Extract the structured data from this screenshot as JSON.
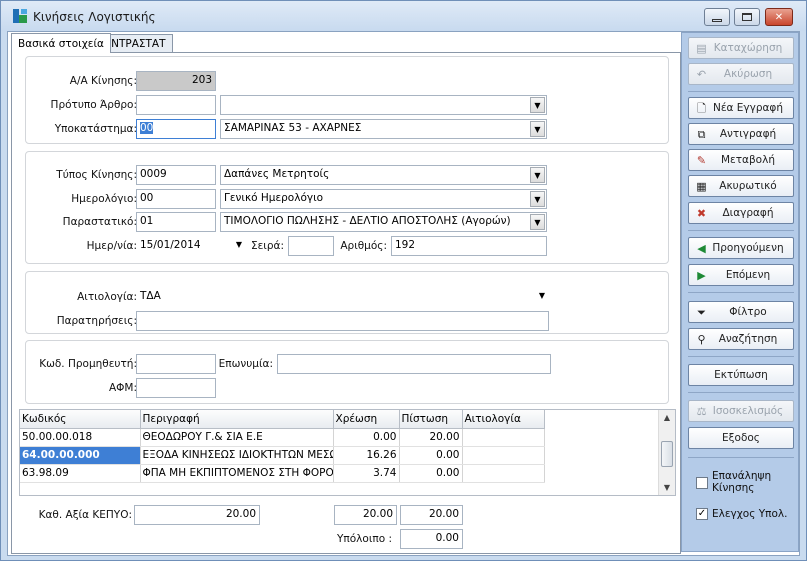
{
  "window": {
    "title": "Κινήσεις Λογιστικής",
    "controls": {
      "minimize": "▭",
      "maximize": "▢",
      "close": "✕"
    }
  },
  "tabs": [
    {
      "label": "Βασικά στοιχεία",
      "active": true
    },
    {
      "label": "ΙΝΤΡΑΣΤΑΤ",
      "active": false
    }
  ],
  "header": {
    "aa_label": "Α/Α Κίνησης:",
    "aa_value": "203",
    "template_label": "Πρότυπο Άρθρο:",
    "template_code": "",
    "template_name": "",
    "branch_label": "Υποκατάστημα:",
    "branch_code": "00",
    "branch_name": "ΣΑΜΑΡΙΝΑΣ 53 - ΑΧΑΡΝΕΣ"
  },
  "movement": {
    "type_label": "Τύπος Κίνησης:",
    "type_code": "0009",
    "type_name": "Δαπάνες Μετρητοίς",
    "journal_label": "Ημερολόγιο:",
    "journal_code": "00",
    "journal_name": "Γενικό Ημερολόγιο",
    "doc_label": "Παραστατικό:",
    "doc_code": "01",
    "doc_name": "ΤΙΜΟΛΟΓΙΟ ΠΩΛΗΣΗΣ - ΔΕΛΤΙΟ ΑΠΟΣΤΟΛΗΣ (Αγορών)",
    "date_label": "Ημερ/νία:",
    "date_value": "15/01/2014",
    "series_label": "Σειρά:",
    "series_value": "",
    "number_label": "Αριθμός:",
    "number_value": "192"
  },
  "reason": {
    "reason_label": "Αιτιολογία:",
    "reason_value": "ΤΔΑ",
    "notes_label": "Παρατηρήσεις:",
    "notes_value": ""
  },
  "supplier": {
    "code_label": "Κωδ. Προμηθευτή:",
    "code_value": "",
    "name_label": "Επωνυμία:",
    "name_value": "",
    "afm_label": "ΑΦΜ:",
    "afm_value": ""
  },
  "grid": {
    "columns": [
      "Κωδικός",
      "Περιγραφή",
      "Χρέωση",
      "Πίστωση",
      "Αιτιολογία"
    ],
    "rows": [
      {
        "code": "50.00.00.018",
        "desc": "ΘΕΟΔΩΡΟΥ Γ.& ΣΙΑ Ε.Ε",
        "debit": "0.00",
        "credit": "20.00",
        "reason": ""
      },
      {
        "code": "64.00.00.000",
        "desc": "ΕΞΟΔΑ ΚΙΝΗΣΕΩΣ ΙΔΙΟΚΤΗΤΩΝ ΜΕΣΩΝ",
        "debit": "16.26",
        "credit": "0.00",
        "reason": ""
      },
      {
        "code": "63.98.09",
        "desc": "ΦΠΑ ΜΗ ΕΚΠΙΠΤΟΜΕΝΟΣ ΣΤΗ ΦΟΡΟΛΟΓΙΑ",
        "debit": "3.74",
        "credit": "0.00",
        "reason": ""
      }
    ]
  },
  "totals": {
    "kepyo_label": "Καθ. Αξία ΚΕΠΥΟ:",
    "kepyo_value": "20.00",
    "debit_total": "20.00",
    "credit_total": "20.00",
    "balance_label": "Υπόλοιπο :",
    "balance_value": "0.00"
  },
  "actions": {
    "save": "Καταχώρηση",
    "cancel": "Ακύρωση",
    "new": "Νέα Εγγραφή",
    "copy": "Αντιγραφή",
    "edit": "Μεταβολή",
    "void": "Ακυρωτικό",
    "delete": "Διαγραφή",
    "prev": "Προηγούμενη",
    "next": "Επόμενη",
    "filter": "Φίλτρο",
    "search": "Αναζήτηση",
    "print": "Εκτύπωση",
    "balance": "Ισοσκελισμός",
    "exit": "Εξοδος",
    "repeat_label": "Επανάληψη Κίνησης",
    "repeat_checked": false,
    "check_label": "Ελεγχος Υπολ.",
    "check_checked": true
  },
  "colors": {
    "accent": "#3e7fd5",
    "panel": "#b4cbe8",
    "window": "#c9dbef"
  }
}
